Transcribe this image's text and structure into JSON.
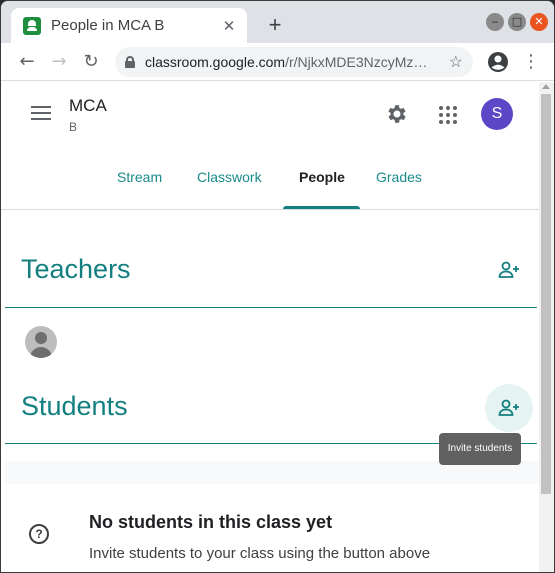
{
  "browser": {
    "tab_title": "People in MCA B",
    "close_symbol": "✕",
    "new_tab_symbol": "+",
    "url_host": "classroom.google.com",
    "url_path": "/r/NjkxMDE3NzcyMz…",
    "min_symbol": "‒",
    "max_symbol": "□",
    "win_close_symbol": "✕"
  },
  "nav": {
    "back": "←",
    "forward": "→",
    "reload": "↻",
    "star": "☆",
    "menu": "⋮"
  },
  "header": {
    "class_name": "MCA",
    "class_section": "B",
    "user_initial": "S"
  },
  "tabs": [
    {
      "label": "Stream"
    },
    {
      "label": "Classwork"
    },
    {
      "label": "People",
      "active": true
    },
    {
      "label": "Grades"
    }
  ],
  "teachers": {
    "title": "Teachers"
  },
  "students": {
    "title": "Students",
    "tooltip": "Invite students"
  },
  "empty_state": {
    "icon": "?",
    "title": "No students in this class yet",
    "text": "Invite students to your class using the button above"
  },
  "colors": {
    "accent": "#137f7f",
    "avatar": "#5c48c7"
  }
}
